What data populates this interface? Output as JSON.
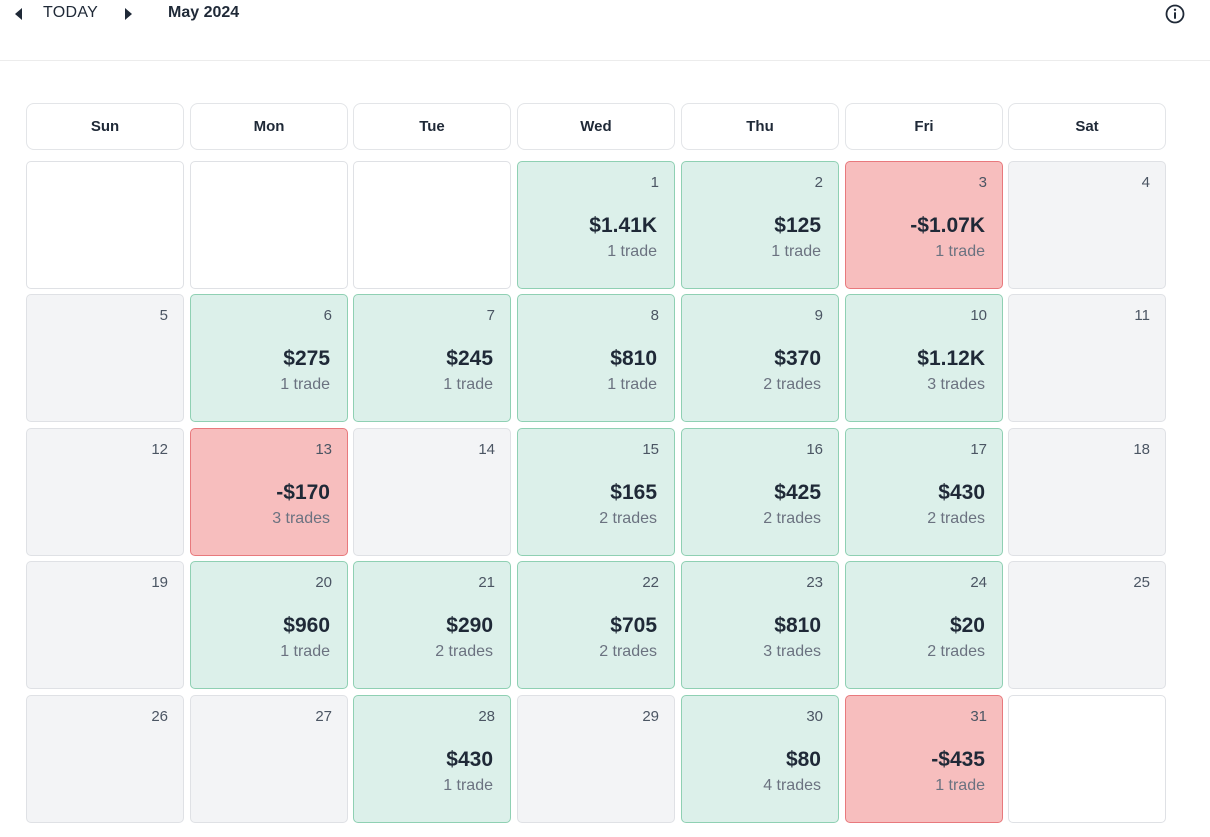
{
  "toolbar": {
    "today_label": "TODAY",
    "month_label": "May 2024",
    "prev_icon": "caret-left-icon",
    "next_icon": "caret-right-icon",
    "info_icon": "info-circle-icon"
  },
  "colors": {
    "win_bg": "#dcf0ea",
    "win_border": "#8fd0b3",
    "loss_bg": "#f7bebe",
    "loss_border": "#e8797d",
    "neutral_bg": "#f3f4f6"
  },
  "weekdays": [
    "Sun",
    "Mon",
    "Tue",
    "Wed",
    "Thu",
    "Fri",
    "Sat"
  ],
  "weeks": [
    [
      {
        "day": "",
        "pnl": "",
        "trades": "",
        "type": "empty"
      },
      {
        "day": "",
        "pnl": "",
        "trades": "",
        "type": "empty"
      },
      {
        "day": "",
        "pnl": "",
        "trades": "",
        "type": "empty"
      },
      {
        "day": "1",
        "pnl": "$1.41K",
        "trades": "1 trade",
        "type": "win"
      },
      {
        "day": "2",
        "pnl": "$125",
        "trades": "1 trade",
        "type": "win"
      },
      {
        "day": "3",
        "pnl": "-$1.07K",
        "trades": "1 trade",
        "type": "loss"
      },
      {
        "day": "4",
        "pnl": "",
        "trades": "",
        "type": "neutral"
      }
    ],
    [
      {
        "day": "5",
        "pnl": "",
        "trades": "",
        "type": "neutral"
      },
      {
        "day": "6",
        "pnl": "$275",
        "trades": "1 trade",
        "type": "win"
      },
      {
        "day": "7",
        "pnl": "$245",
        "trades": "1 trade",
        "type": "win"
      },
      {
        "day": "8",
        "pnl": "$810",
        "trades": "1 trade",
        "type": "win"
      },
      {
        "day": "9",
        "pnl": "$370",
        "trades": "2 trades",
        "type": "win"
      },
      {
        "day": "10",
        "pnl": "$1.12K",
        "trades": "3 trades",
        "type": "win"
      },
      {
        "day": "11",
        "pnl": "",
        "trades": "",
        "type": "neutral"
      }
    ],
    [
      {
        "day": "12",
        "pnl": "",
        "trades": "",
        "type": "neutral"
      },
      {
        "day": "13",
        "pnl": "-$170",
        "trades": "3 trades",
        "type": "loss"
      },
      {
        "day": "14",
        "pnl": "",
        "trades": "",
        "type": "neutral"
      },
      {
        "day": "15",
        "pnl": "$165",
        "trades": "2 trades",
        "type": "win"
      },
      {
        "day": "16",
        "pnl": "$425",
        "trades": "2 trades",
        "type": "win"
      },
      {
        "day": "17",
        "pnl": "$430",
        "trades": "2 trades",
        "type": "win"
      },
      {
        "day": "18",
        "pnl": "",
        "trades": "",
        "type": "neutral"
      }
    ],
    [
      {
        "day": "19",
        "pnl": "",
        "trades": "",
        "type": "neutral"
      },
      {
        "day": "20",
        "pnl": "$960",
        "trades": "1 trade",
        "type": "win"
      },
      {
        "day": "21",
        "pnl": "$290",
        "trades": "2 trades",
        "type": "win"
      },
      {
        "day": "22",
        "pnl": "$705",
        "trades": "2 trades",
        "type": "win"
      },
      {
        "day": "23",
        "pnl": "$810",
        "trades": "3 trades",
        "type": "win"
      },
      {
        "day": "24",
        "pnl": "$20",
        "trades": "2 trades",
        "type": "win"
      },
      {
        "day": "25",
        "pnl": "",
        "trades": "",
        "type": "neutral"
      }
    ],
    [
      {
        "day": "26",
        "pnl": "",
        "trades": "",
        "type": "neutral"
      },
      {
        "day": "27",
        "pnl": "",
        "trades": "",
        "type": "neutral"
      },
      {
        "day": "28",
        "pnl": "$430",
        "trades": "1 trade",
        "type": "win"
      },
      {
        "day": "29",
        "pnl": "",
        "trades": "",
        "type": "neutral"
      },
      {
        "day": "30",
        "pnl": "$80",
        "trades": "4 trades",
        "type": "win"
      },
      {
        "day": "31",
        "pnl": "-$435",
        "trades": "1 trade",
        "type": "loss"
      },
      {
        "day": "",
        "pnl": "",
        "trades": "",
        "type": "empty"
      }
    ]
  ]
}
